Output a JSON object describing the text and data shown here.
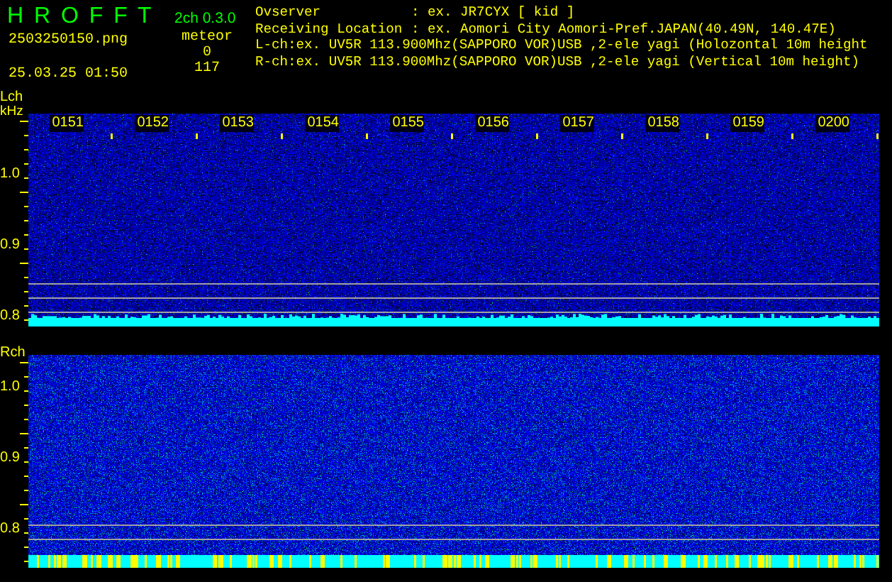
{
  "header": {
    "app_title": "H R O F F T",
    "version": "2ch 0.3.0",
    "filename": "2503250150.png",
    "datetime": "25.03.25 01:50",
    "meteor_label": "meteor",
    "meteor_counts": [
      "0",
      "117"
    ]
  },
  "info": [
    {
      "label": "Ovserver",
      "value": ": ex. JR7CYX [ kid ]"
    },
    {
      "label": "Receiving Location",
      "value": ": ex. Aomori City Aomori-Pref.JAPAN(40.49N, 140.47E)"
    }
  ],
  "channel_lines": [
    "L-ch:ex. UV5R 113.900Mhz(SAPPORO VOR)USB ,2-ele yagi (Holozontal 10m height",
    "R-ch:ex. UV5R 113.900Mhz(SAPPORO VOR)USB ,2-ele yagi (Vertical 10m height)"
  ],
  "panels": [
    {
      "channel": "Lch",
      "unit": "kHz",
      "y_labels": [
        "1.0",
        "0.9",
        "0.8"
      ],
      "time_labels": [
        "0151",
        "0152",
        "0153",
        "0154",
        "0155",
        "0156",
        "0157",
        "0158",
        "0159",
        "0200"
      ]
    },
    {
      "channel": "Rch",
      "y_labels": [
        "1.0",
        "0.9",
        "0.8"
      ]
    }
  ]
}
